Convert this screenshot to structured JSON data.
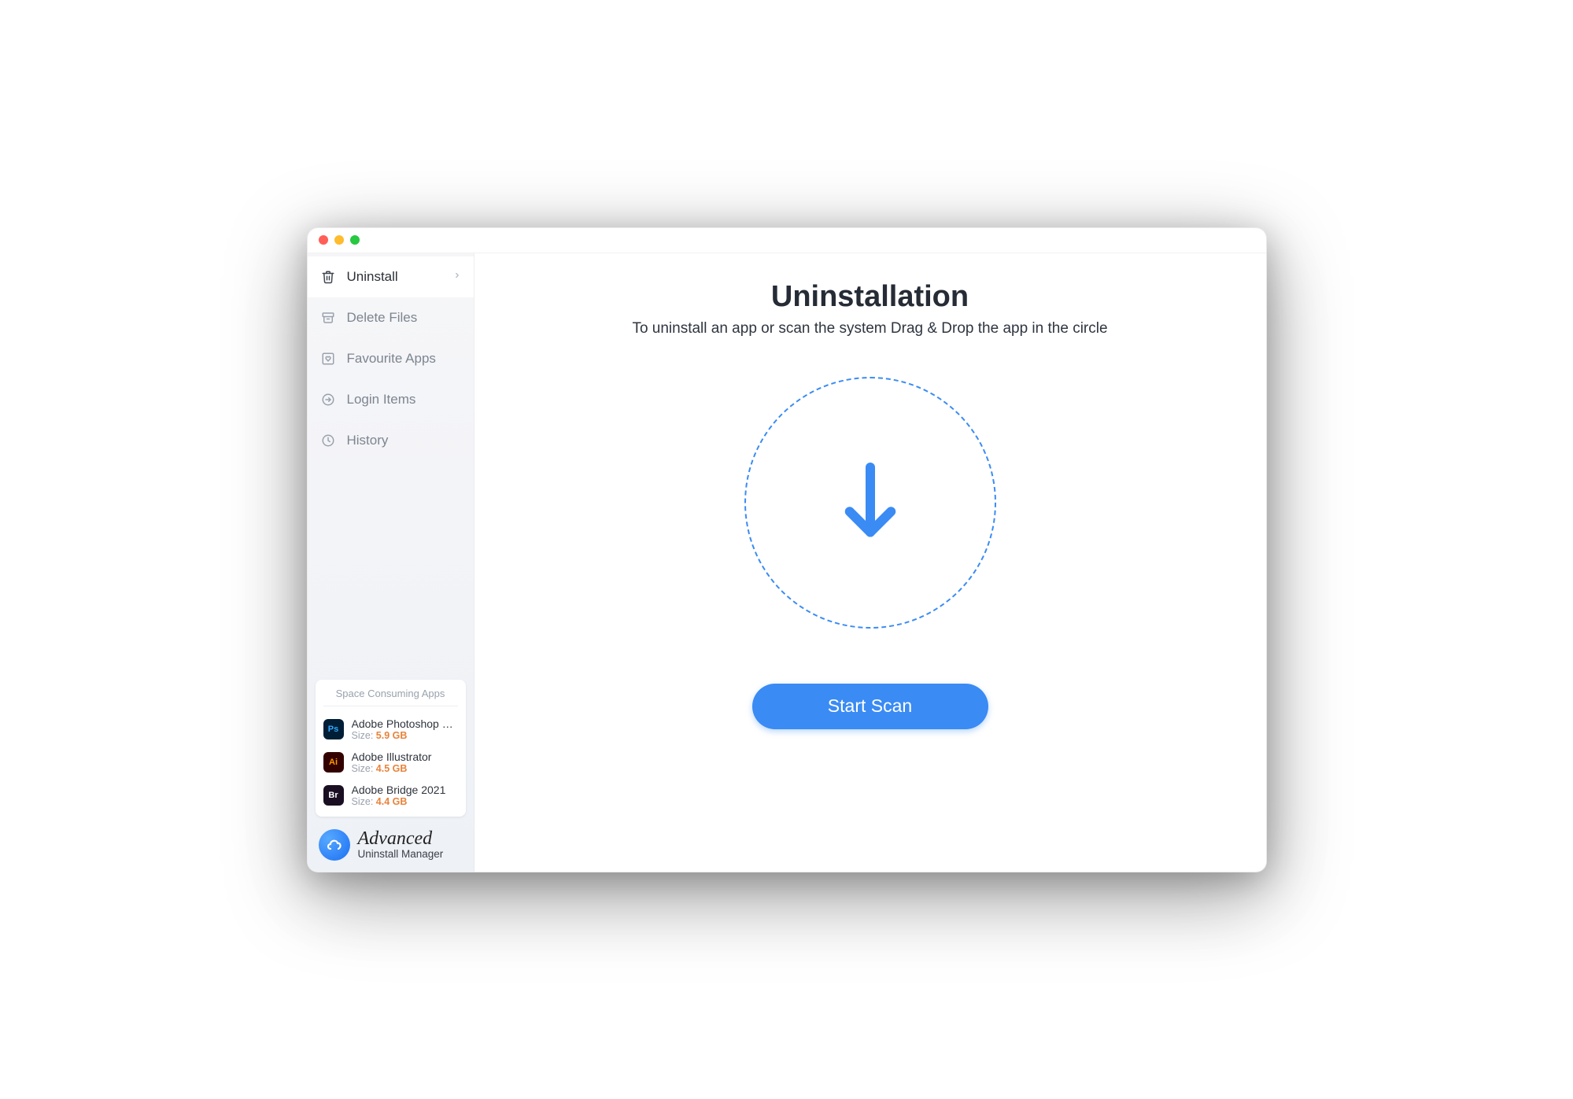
{
  "sidebar": {
    "items": [
      {
        "label": "Uninstall",
        "icon": "trash-icon",
        "active": true
      },
      {
        "label": "Delete Files",
        "icon": "archive-icon",
        "active": false
      },
      {
        "label": "Favourite Apps",
        "icon": "heart-box-icon",
        "active": false
      },
      {
        "label": "Login Items",
        "icon": "login-arrow-icon",
        "active": false
      },
      {
        "label": "History",
        "icon": "clock-icon",
        "active": false
      }
    ],
    "space_card": {
      "title": "Space Consuming Apps",
      "size_label": "Size:",
      "apps": [
        {
          "name": "Adobe Photoshop 2…",
          "size": "5.9 GB",
          "icon_text": "Ps",
          "icon_class": "ic-ps"
        },
        {
          "name": "Adobe Illustrator",
          "size": "4.5 GB",
          "icon_text": "Ai",
          "icon_class": "ic-ai"
        },
        {
          "name": "Adobe Bridge 2021",
          "size": "4.4 GB",
          "icon_text": "Br",
          "icon_class": "ic-br"
        }
      ]
    },
    "brand": {
      "line1": "Advanced",
      "line2": "Uninstall Manager"
    }
  },
  "main": {
    "title": "Uninstallation",
    "subtitle": "To uninstall an app or scan the system Drag & Drop the app in the circle",
    "button": "Start Scan"
  }
}
